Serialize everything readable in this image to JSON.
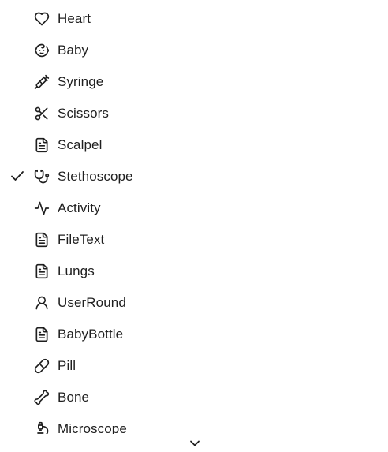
{
  "menu": {
    "items": [
      {
        "label": "Heart",
        "icon": "heart-icon",
        "selected": false
      },
      {
        "label": "Baby",
        "icon": "baby-icon",
        "selected": false
      },
      {
        "label": "Syringe",
        "icon": "syringe-icon",
        "selected": false
      },
      {
        "label": "Scissors",
        "icon": "scissors-icon",
        "selected": false
      },
      {
        "label": "Scalpel",
        "icon": "file-text-icon",
        "selected": false
      },
      {
        "label": "Stethoscope",
        "icon": "stethoscope-icon",
        "selected": true
      },
      {
        "label": "Activity",
        "icon": "activity-icon",
        "selected": false
      },
      {
        "label": "FileText",
        "icon": "file-text-icon",
        "selected": false
      },
      {
        "label": "Lungs",
        "icon": "file-text-icon",
        "selected": false
      },
      {
        "label": "UserRound",
        "icon": "user-round-icon",
        "selected": false
      },
      {
        "label": "BabyBottle",
        "icon": "file-text-icon",
        "selected": false
      },
      {
        "label": "Pill",
        "icon": "pill-icon",
        "selected": false
      },
      {
        "label": "Bone",
        "icon": "bone-icon",
        "selected": false
      },
      {
        "label": "Microscope",
        "icon": "microscope-icon",
        "selected": false
      }
    ],
    "scroll_indicator_icon": "chevron-down-icon"
  }
}
